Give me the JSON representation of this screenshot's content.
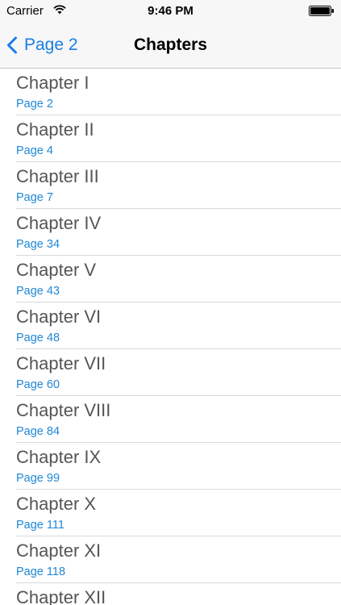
{
  "status_bar": {
    "carrier": "Carrier",
    "time": "9:46 PM",
    "wifi_icon": "wifi-icon",
    "battery_icon": "battery-icon"
  },
  "nav_bar": {
    "back_label": "Page 2",
    "back_icon": "chevron-left-icon",
    "title": "Chapters",
    "accent_color": "#1a7ce6"
  },
  "chapters": [
    {
      "title": "Chapter I",
      "page": "Page 2"
    },
    {
      "title": "Chapter II",
      "page": "Page 4"
    },
    {
      "title": "Chapter III",
      "page": "Page 7"
    },
    {
      "title": "Chapter IV",
      "page": "Page 34"
    },
    {
      "title": "Chapter V",
      "page": "Page 43"
    },
    {
      "title": "Chapter VI",
      "page": "Page 48"
    },
    {
      "title": "Chapter VII",
      "page": "Page 60"
    },
    {
      "title": "Chapter VIII",
      "page": "Page 84"
    },
    {
      "title": "Chapter IX",
      "page": "Page 99"
    },
    {
      "title": "Chapter X",
      "page": "Page 111"
    },
    {
      "title": "Chapter XI",
      "page": "Page 118"
    },
    {
      "title": "Chapter XII",
      "page": ""
    }
  ]
}
